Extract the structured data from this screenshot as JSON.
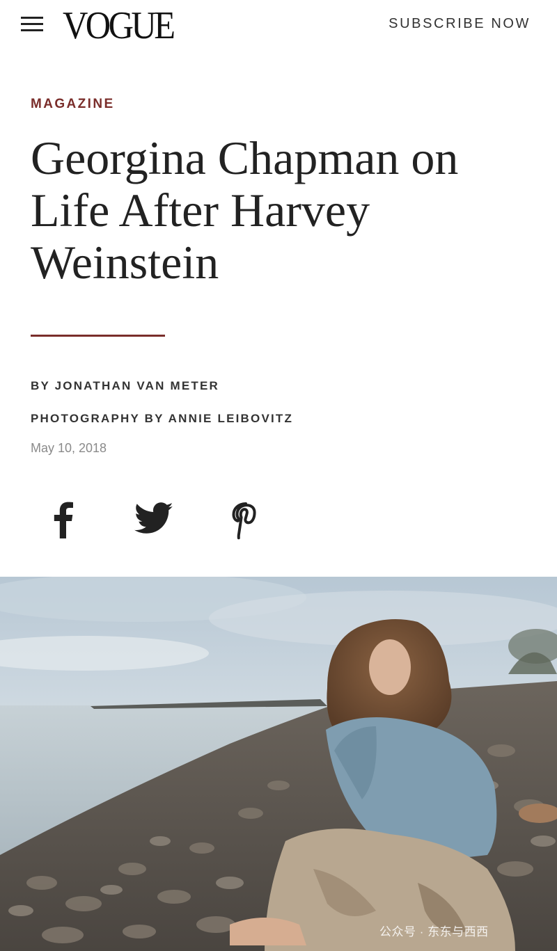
{
  "header": {
    "logo": "VOGUE",
    "subscribe_label": "SUBSCRIBE NOW",
    "menu_icon": "hamburger-menu-icon"
  },
  "article": {
    "rubric": "MAGAZINE",
    "headline": "Georgina Chapman on Life After Harvey Weinstein",
    "byline": "BY JONATHAN VAN METER",
    "photo_credit": "PHOTOGRAPHY BY ANNIE LEIBOVITZ",
    "date": "May 10, 2018"
  },
  "share": [
    {
      "icon": "facebook-icon"
    },
    {
      "icon": "twitter-icon"
    },
    {
      "icon": "pinterest-icon"
    }
  ],
  "watermark": "公众号 · 东东与西西",
  "colors": {
    "accent": "#7a2d2a",
    "text": "#222222",
    "muted": "#8a8a8a",
    "background": "#ffffff"
  }
}
